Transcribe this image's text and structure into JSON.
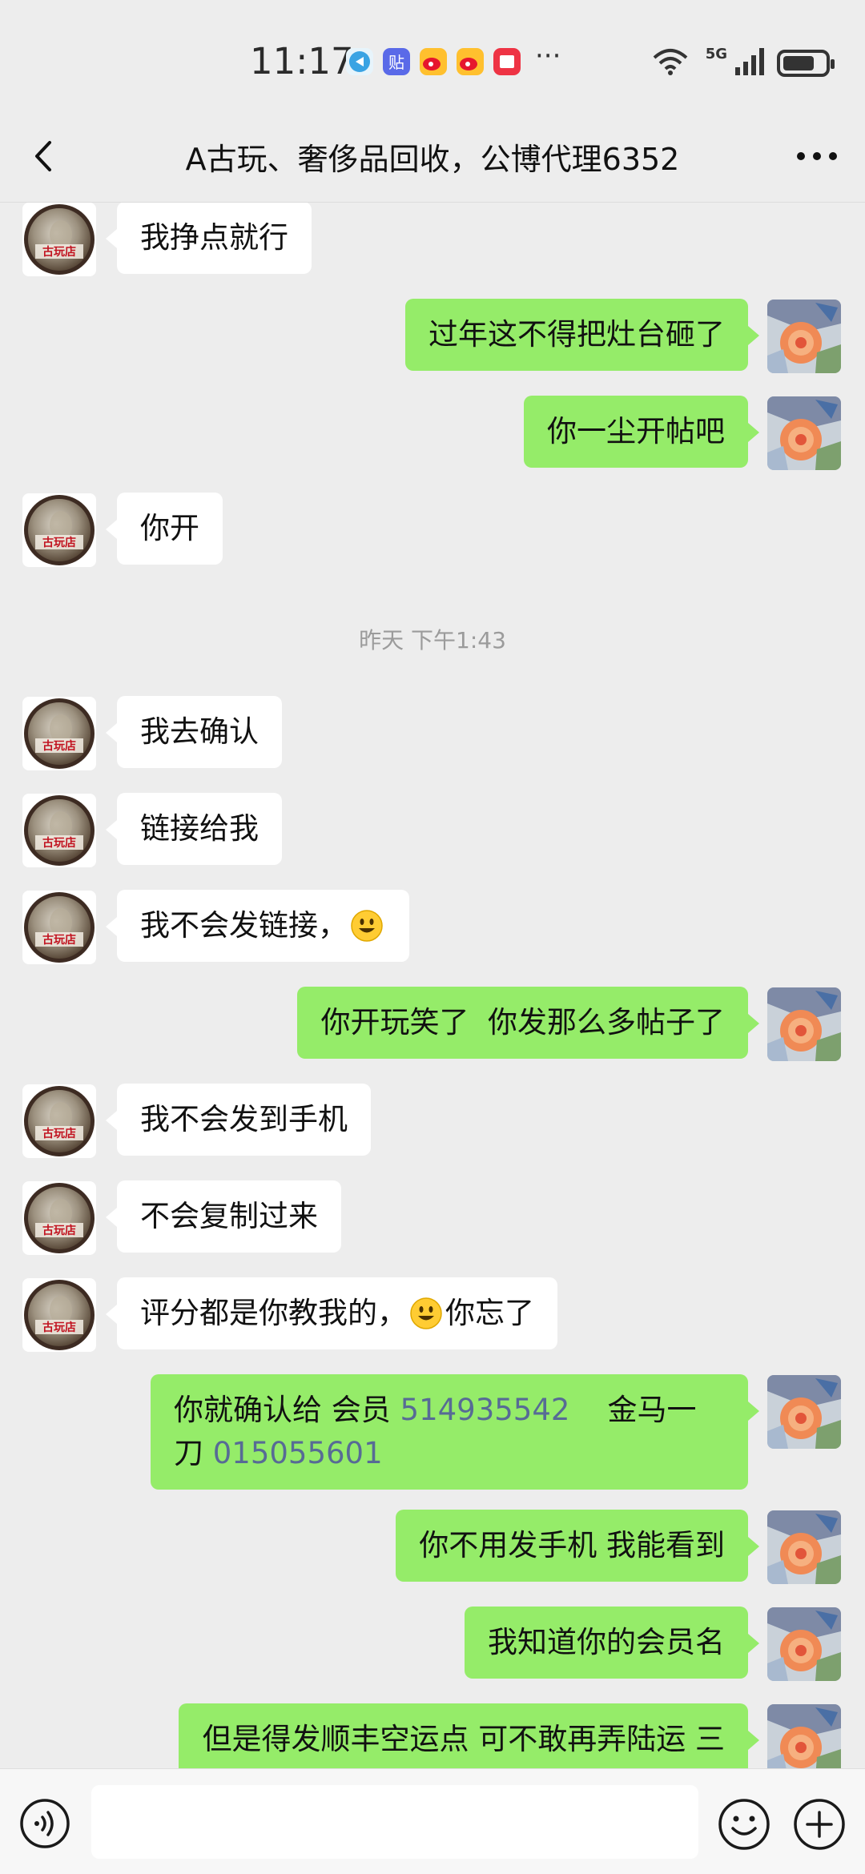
{
  "status_bar": {
    "time": "11:17",
    "network": "5G",
    "notification_icons": [
      "app-icon",
      "tieba-icon",
      "weibo-icon",
      "weibo-icon",
      "book-icon"
    ],
    "more_symbol": "···"
  },
  "nav": {
    "title": "A古玩、奢侈品回收，公博代理6352"
  },
  "avatar_badge": "古玩店",
  "messages": [
    {
      "side": "left",
      "text": "我挣点就行"
    },
    {
      "side": "right",
      "text": "过年这不得把灶台砸了"
    },
    {
      "side": "right",
      "text": "你一尘开帖吧"
    },
    {
      "side": "left",
      "text": "你开"
    },
    {
      "side": "left",
      "text": "我去确认"
    },
    {
      "side": "left",
      "text": "链接给我"
    },
    {
      "side": "left",
      "text": "我不会发链接，"
    },
    {
      "side": "right",
      "text": "你开玩笑了  你发那么多帖子了"
    },
    {
      "side": "left",
      "text": "我不会发到手机"
    },
    {
      "side": "left",
      "text": "不会复制过来"
    },
    {
      "side": "left",
      "text_before": "评分都是你教我的，",
      "text_after": "你忘了"
    },
    {
      "side": "right",
      "parts": [
        "你就确认给 会员 ",
        "514935542",
        "    金马一刀 ",
        "015055601"
      ]
    },
    {
      "side": "right",
      "text": "你不用发手机 我能看到"
    },
    {
      "side": "right",
      "text": "我知道你的会员名"
    },
    {
      "side": "right",
      "text": "但是得发顺丰空运点 可不敢再弄陆运 三"
    }
  ],
  "timestamp": "昨天 下午1:43",
  "input": {
    "placeholder": ""
  },
  "colors": {
    "background": "#ededed",
    "bubble_self": "#95ec69",
    "bubble_other": "#ffffff",
    "link": "#576b95"
  }
}
